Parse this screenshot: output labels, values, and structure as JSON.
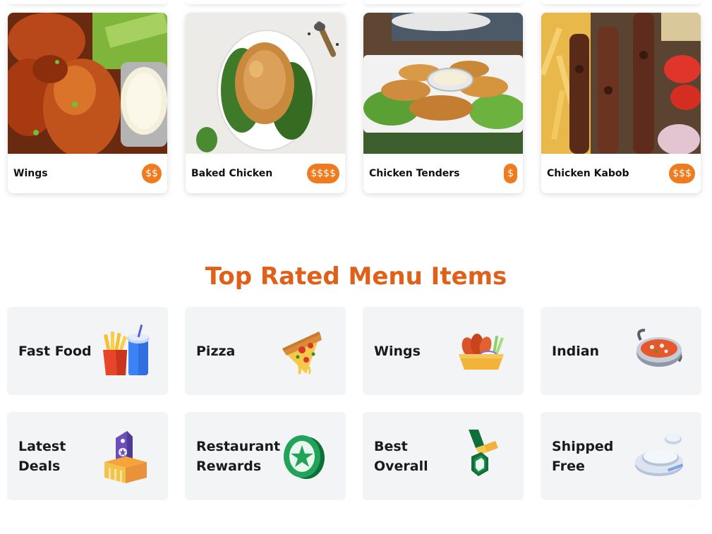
{
  "food_cards": [
    {
      "name": "Wings",
      "price": "$$"
    },
    {
      "name": "Baked Chicken",
      "price": "$$$$"
    },
    {
      "name": "Chicken Tenders",
      "price": "$"
    },
    {
      "name": "Chicken Kabob",
      "price": "$$$"
    }
  ],
  "section_title": "Top Rated Menu Items",
  "menu_tiles": [
    {
      "label": "Fast Food",
      "icon": "fast-food-icon"
    },
    {
      "label": "Pizza",
      "icon": "pizza-icon"
    },
    {
      "label": "Wings",
      "icon": "wings-icon"
    },
    {
      "label": "Indian",
      "icon": "indian-curry-icon"
    },
    {
      "label": "Latest Deals",
      "icon": "deals-tag-icon"
    },
    {
      "label": "Restaurant Rewards",
      "icon": "rewards-coin-icon"
    },
    {
      "label": "Best Overall",
      "icon": "medal-icon"
    },
    {
      "label": "Shipped Free",
      "icon": "plates-icon"
    }
  ],
  "colors": {
    "accent": "#e0601a",
    "price_badge": "#f07a1e",
    "tile_bg": "#f3f4f6"
  }
}
